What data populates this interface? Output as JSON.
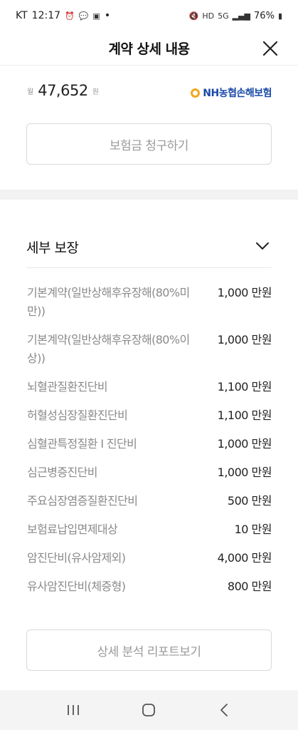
{
  "status_bar": {
    "carrier": "KT",
    "time": "12:17",
    "dot": "•",
    "network": "5G",
    "battery": "76%"
  },
  "header": {
    "title": "계약 상세 내용"
  },
  "premium": {
    "unit_prefix": "월",
    "amount": "47,652",
    "unit_suffix": "원",
    "brand": "NH농협손해보험"
  },
  "buttons": {
    "claim": "보험금 청구하기",
    "report": "상세 분석 리포트보기"
  },
  "detail": {
    "title": "세부 보장",
    "items": [
      {
        "name": "기본계약(일반상해후유장해(80%미만))",
        "amount": "1,000 만원"
      },
      {
        "name": "기본계약(일반상해후유장해(80%이상))",
        "amount": "1,000 만원"
      },
      {
        "name": "뇌혈관질환진단비",
        "amount": "1,100 만원"
      },
      {
        "name": "허혈성심장질환진단비",
        "amount": "1,100 만원"
      },
      {
        "name": "심혈관특정질환 Ⅰ 진단비",
        "amount": "1,000 만원"
      },
      {
        "name": "심근병증진단비",
        "amount": "1,000 만원"
      },
      {
        "name": "주요심장염증질환진단비",
        "amount": "500 만원"
      },
      {
        "name": "보험료납입면제대상",
        "amount": "10 만원"
      },
      {
        "name": "암진단비(유사암제외)",
        "amount": "4,000 만원"
      },
      {
        "name": "유사암진단비(체증형)",
        "amount": "800 만원"
      }
    ]
  },
  "icons": {
    "close": "close-icon",
    "chevron": "chevron-down-icon",
    "nav_recent": "recent-apps-icon",
    "nav_home": "home-icon",
    "nav_back": "back-icon"
  }
}
